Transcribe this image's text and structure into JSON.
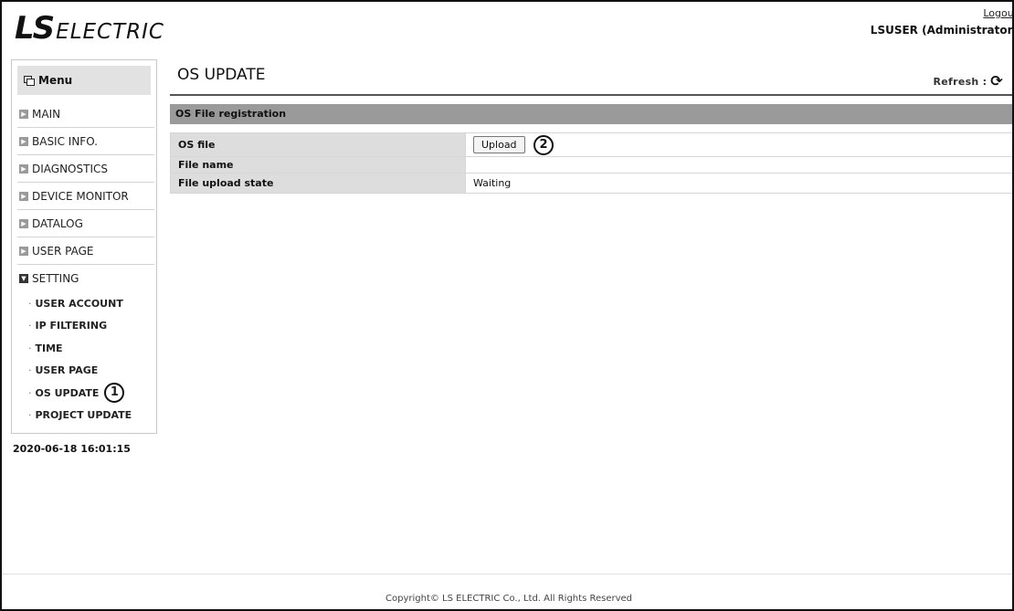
{
  "brand": {
    "logo_ls": "LS",
    "logo_rest": "ELECTRIC"
  },
  "header": {
    "logout_label": "Logout",
    "user_label": "LSUSER (Administrator)"
  },
  "sidebar": {
    "menu_title": "Menu",
    "items": [
      {
        "label": "MAIN"
      },
      {
        "label": "BASIC INFO."
      },
      {
        "label": "DIAGNOSTICS"
      },
      {
        "label": "DEVICE MONITOR"
      },
      {
        "label": "DATALOG"
      },
      {
        "label": "USER PAGE"
      },
      {
        "label": "SETTING"
      }
    ],
    "setting_sub": [
      {
        "label": "USER ACCOUNT"
      },
      {
        "label": "IP FILTERING"
      },
      {
        "label": "TIME"
      },
      {
        "label": "USER PAGE"
      },
      {
        "label": "OS UPDATE"
      },
      {
        "label": "PROJECT UPDATE"
      }
    ],
    "timestamp": "2020-06-18 16:01:15"
  },
  "main": {
    "title": "OS UPDATE",
    "refresh_label": "Refresh",
    "refresh_sep": ":",
    "section_title": "OS File registration",
    "rows": [
      {
        "label": "OS file",
        "button": "Upload"
      },
      {
        "label": "File name",
        "value": ""
      },
      {
        "label": "File upload state",
        "value": "Waiting"
      }
    ]
  },
  "annotations": {
    "one": "1",
    "two": "2"
  },
  "footer": {
    "copyright": "Copyright© LS ELECTRIC Co., Ltd. All Rights Reserved"
  }
}
